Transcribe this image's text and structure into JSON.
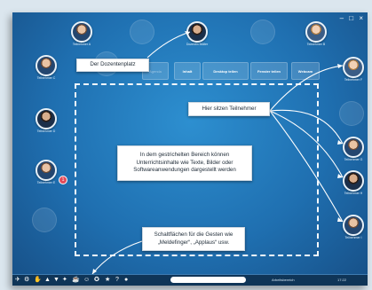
{
  "window": {
    "controls": "– □ ×"
  },
  "callouts": {
    "lecturer": "Der Dozentenplatz",
    "participants": "Hier sitzen Teilnehmer",
    "area_line1": "In dem gestrichelten Bereich können",
    "area_line2": "Unterrichtsinhalte wie Texte, Bilder oder",
    "area_line3": "Softwareanwendungen dargestellt werden",
    "gestures_line1": "Schaltflächen für die Gesten wie",
    "gestures_line2": "„Meldefinger“, „Applaus“ usw."
  },
  "lecturer": {
    "name": "Dozentin Müller"
  },
  "participants": {
    "top_left": "Teilnehmer A",
    "top_right": "Teilnehmer B",
    "left_1": "Teilnehmer C",
    "left_2": "Teilnehmer D",
    "left_3": "Teilnehmer E",
    "right_1": "Teilnehmer F",
    "right_2": "Teilnehmer G",
    "right_3": "Teilnehmer H",
    "right_4": "Teilnehmer I"
  },
  "toolbar": {
    "agenda": "Agenda",
    "content": "Inhalt",
    "desktop": "Desktop teilen",
    "webcam": "Webcam",
    "window": "Fenster teilen",
    "whiteboard": "Whiteboard"
  },
  "bottom": {
    "status_label": "Arbeitsbereich",
    "time": "17:22",
    "badge": "1"
  },
  "colors": {
    "background": "#1f6fb0",
    "dashed_border": "#f4f8fb",
    "callout_bg": "#ffffff",
    "connector": "#ffffff"
  },
  "icons": [
    "paper-plane-icon",
    "hand-raise-icon",
    "thumbs-up-icon",
    "thumbs-down-icon",
    "applause-icon",
    "coffee-icon",
    "question-icon",
    "settings-icon",
    "smiley-icon",
    "emoji-icon"
  ]
}
